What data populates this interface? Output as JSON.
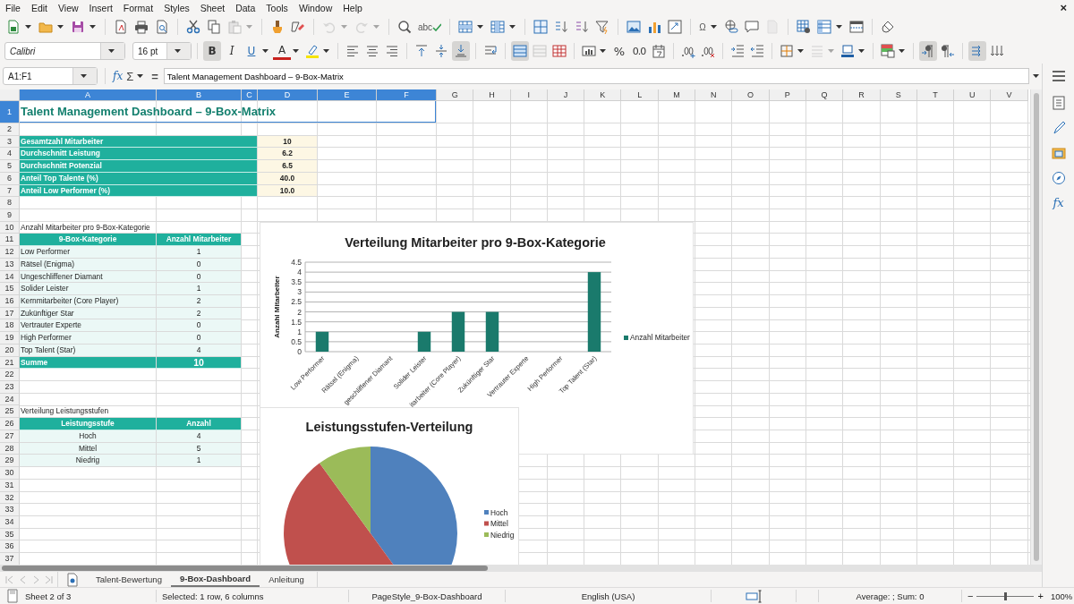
{
  "menu": [
    "File",
    "Edit",
    "View",
    "Insert",
    "Format",
    "Styles",
    "Sheet",
    "Data",
    "Tools",
    "Window",
    "Help"
  ],
  "close_glyph": "×",
  "standard_toolbar": [
    {
      "disabled": false
    },
    {
      "disabled": false
    },
    {
      "disabled": false
    },
    {
      "disabled": false
    },
    {
      "disabled": false
    },
    {
      "disabled": false
    },
    {
      "disabled": false
    },
    {
      "disabled": false
    },
    {
      "disabled": true
    },
    {
      "disabled": false
    },
    {
      "disabled": false
    },
    {
      "disabled": true
    },
    {
      "disabled": true
    },
    {
      "disabled": false
    },
    {
      "text": "abc",
      "disabled": false
    },
    {
      "disabled": false
    },
    {
      "disabled": false
    },
    {
      "disabled": false
    },
    {
      "disabled": false
    },
    {
      "disabled": false
    },
    {
      "disabled": false
    },
    {
      "disabled": false
    },
    {
      "disabled": false
    },
    {
      "disabled": false
    },
    {
      "text": "Ω",
      "disabled": false
    },
    {
      "disabled": false
    },
    {
      "disabled": false
    },
    {
      "disabled": true
    },
    {
      "disabled": false
    },
    {
      "disabled": false
    },
    {
      "disabled": false
    },
    {
      "disabled": false
    }
  ],
  "font_name": "Calibri",
  "font_size": "16 pt",
  "format_toolbar": [
    {
      "text": "B",
      "on": true,
      "disabled": false
    },
    {
      "text": "I",
      "on": false,
      "disabled": false
    },
    {
      "text": "U",
      "on": false,
      "disabled": false
    },
    {
      "text": "A",
      "on": false,
      "disabled": false
    },
    {
      "on": false,
      "disabled": false
    },
    {
      "on": false,
      "disabled": false
    },
    {
      "on": false,
      "disabled": false
    },
    {
      "on": false,
      "disabled": false
    },
    {
      "on": false,
      "disabled": false
    },
    {
      "on": false,
      "disabled": false
    },
    {
      "on": true,
      "disabled": false
    },
    {
      "on": false,
      "disabled": false
    },
    {
      "on": true,
      "disabled": false
    },
    {
      "on": false,
      "disabled": true
    },
    {
      "on": false,
      "disabled": false
    },
    {
      "on": false,
      "disabled": false
    },
    {
      "text": "%",
      "on": false,
      "disabled": false
    },
    {
      "text": "0.0",
      "on": false,
      "disabled": false
    },
    {
      "on": false,
      "disabled": false
    },
    {
      "on": false,
      "disabled": false
    },
    {
      "on": false,
      "disabled": false
    },
    {
      "on": false,
      "disabled": false
    },
    {
      "on": false,
      "disabled": false
    },
    {
      "on": false,
      "disabled": false
    },
    {
      "on": false,
      "disabled": true
    },
    {
      "on": false,
      "disabled": false
    },
    {
      "on": false,
      "disabled": false
    },
    {
      "on": true,
      "disabled": false
    },
    {
      "on": false,
      "disabled": false
    },
    {
      "on": true,
      "disabled": false
    },
    {
      "on": false,
      "disabled": false
    }
  ],
  "formula_bar": {
    "name_box": "A1:F1",
    "function_wizard": "fx",
    "sum": "Σ",
    "equals": "=",
    "content": "Talent Management Dashboard – 9-Box-Matrix"
  },
  "sidebar": {
    "functions": "fx"
  },
  "columns": [
    {
      "label": "A",
      "selected": true
    },
    {
      "label": "B",
      "selected": true
    },
    {
      "label": "C",
      "selected": true
    },
    {
      "label": "D",
      "selected": true
    },
    {
      "label": "E",
      "selected": true
    },
    {
      "label": "F",
      "selected": true
    },
    {
      "label": "G",
      "selected": false
    },
    {
      "label": "H",
      "selected": false
    },
    {
      "label": "I",
      "selected": false
    },
    {
      "label": "J",
      "selected": false
    },
    {
      "label": "K",
      "selected": false
    },
    {
      "label": "L",
      "selected": false
    },
    {
      "label": "M",
      "selected": false
    },
    {
      "label": "N",
      "selected": false
    },
    {
      "label": "O",
      "selected": false
    },
    {
      "label": "P",
      "selected": false
    },
    {
      "label": "Q",
      "selected": false
    },
    {
      "label": "R",
      "selected": false
    },
    {
      "label": "S",
      "selected": false
    },
    {
      "label": "T",
      "selected": false
    },
    {
      "label": "U",
      "selected": false
    },
    {
      "label": "V",
      "selected": false
    }
  ],
  "rows": [
    {
      "label": "1",
      "selected": true
    },
    {
      "label": "2",
      "selected": false
    },
    {
      "label": "3",
      "selected": false
    },
    {
      "label": "4",
      "selected": false
    },
    {
      "label": "5",
      "selected": false
    },
    {
      "label": "6",
      "selected": false
    },
    {
      "label": "7",
      "selected": false
    },
    {
      "label": "8",
      "selected": false
    },
    {
      "label": "9",
      "selected": false
    },
    {
      "label": "10",
      "selected": false
    },
    {
      "label": "11",
      "selected": false
    },
    {
      "label": "12",
      "selected": false
    },
    {
      "label": "13",
      "selected": false
    },
    {
      "label": "14",
      "selected": false
    },
    {
      "label": "15",
      "selected": false
    },
    {
      "label": "16",
      "selected": false
    },
    {
      "label": "17",
      "selected": false
    },
    {
      "label": "18",
      "selected": false
    },
    {
      "label": "19",
      "selected": false
    },
    {
      "label": "20",
      "selected": false
    },
    {
      "label": "21",
      "selected": false
    },
    {
      "label": "22",
      "selected": false
    },
    {
      "label": "23",
      "selected": false
    },
    {
      "label": "24",
      "selected": false
    },
    {
      "label": "25",
      "selected": false
    },
    {
      "label": "26",
      "selected": false
    },
    {
      "label": "27",
      "selected": false
    },
    {
      "label": "28",
      "selected": false
    },
    {
      "label": "29",
      "selected": false
    },
    {
      "label": "30",
      "selected": false
    },
    {
      "label": "31",
      "selected": false
    },
    {
      "label": "32",
      "selected": false
    },
    {
      "label": "33",
      "selected": false
    },
    {
      "label": "34",
      "selected": false
    },
    {
      "label": "35",
      "selected": false
    },
    {
      "label": "36",
      "selected": false
    },
    {
      "label": "37",
      "selected": false
    }
  ],
  "sheet": {
    "title": "Talent Management Dashboard – 9-Box-Matrix",
    "summary": [
      {
        "label": "Gesamtzahl Mitarbeiter",
        "value": "10"
      },
      {
        "label": "Durchschnitt Leistung",
        "value": "6.2"
      },
      {
        "label": "Durchschnitt Potenzial",
        "value": "6.5"
      },
      {
        "label": "Anteil Top Talente (%)",
        "value": "40.0"
      },
      {
        "label": "Anteil Low Performer (%)",
        "value": "10.0"
      }
    ],
    "category_table": {
      "caption": "Anzahl Mitarbeiter pro 9-Box-Kategorie",
      "columns": [
        "9-Box-Kategorie",
        "Anzahl Mitarbeiter"
      ],
      "rows": [
        [
          "Low Performer",
          "1"
        ],
        [
          "Rätsel (Enigma)",
          "0"
        ],
        [
          "Ungeschliffener Diamant",
          "0"
        ],
        [
          "Solider Leister",
          "1"
        ],
        [
          "Kernmitarbeiter (Core Player)",
          "2"
        ],
        [
          "Zukünftiger Star",
          "2"
        ],
        [
          "Vertrauter Experte",
          "0"
        ],
        [
          "High Performer",
          "0"
        ],
        [
          "Top Talent (Star)",
          "4"
        ]
      ],
      "total": [
        "Summe",
        "10"
      ]
    },
    "level_table": {
      "caption": "Verteilung Leistungsstufen",
      "columns": [
        "Leistungsstufe",
        "Anzahl"
      ],
      "rows": [
        [
          "Hoch",
          "4"
        ],
        [
          "Mittel",
          "5"
        ],
        [
          "Niedrig",
          "1"
        ]
      ]
    }
  },
  "bar_chart": {
    "chart_data": {
      "type": "bar",
      "title": "Verteilung Mitarbeiter pro 9-Box-Kategorie",
      "ylabel": "Anzahl Mitarbeiter",
      "categories": [
        "Low Performer",
        "Rätsel (Enigma)",
        "geschliffener Diamant",
        "Solider Leister",
        "itarbeiter (Core Player)",
        "Zukünftiger Star",
        "Vertrauter Experte",
        "High Performer",
        "Top Talent (Star)"
      ],
      "series": [
        {
          "name": "Anzahl Mitarbeiter",
          "color": "#1a7a6c",
          "values": [
            1,
            0,
            0,
            1,
            2,
            2,
            0,
            0,
            4
          ]
        }
      ],
      "ylim": [
        0,
        4.5
      ],
      "yticks": [
        0,
        0.5,
        1,
        1.5,
        2,
        2.5,
        3,
        3.5,
        4,
        4.5
      ],
      "grid": true,
      "legend": true
    }
  },
  "pie_chart": {
    "chart_data": {
      "type": "pie",
      "title": "Leistungsstufen-Verteilung",
      "categories": [
        "Hoch",
        "Mittel",
        "Niedrig"
      ],
      "series": [
        {
          "values": [
            40,
            50,
            10
          ]
        }
      ],
      "colors": [
        "#4f81bd",
        "#c0504d",
        "#9bbb59"
      ],
      "legend": true
    }
  },
  "sheet_tabs": [
    {
      "label": "Talent-Bewertung",
      "selected": false
    },
    {
      "label": "9-Box-Dashboard",
      "selected": true
    },
    {
      "label": "Anleitung",
      "selected": false
    }
  ],
  "status_bar": {
    "sheet": "Sheet 2 of 3",
    "selection": "Selected: 1 row, 6 columns",
    "page_style": "PageStyle_9-Box-Dashboard",
    "language": "English (USA)",
    "sum": "Average: ; Sum: 0",
    "zoom_out": "−",
    "zoom_in": "+",
    "zoom_slider": {
      "level": 0.5
    },
    "zoom": "100%"
  }
}
